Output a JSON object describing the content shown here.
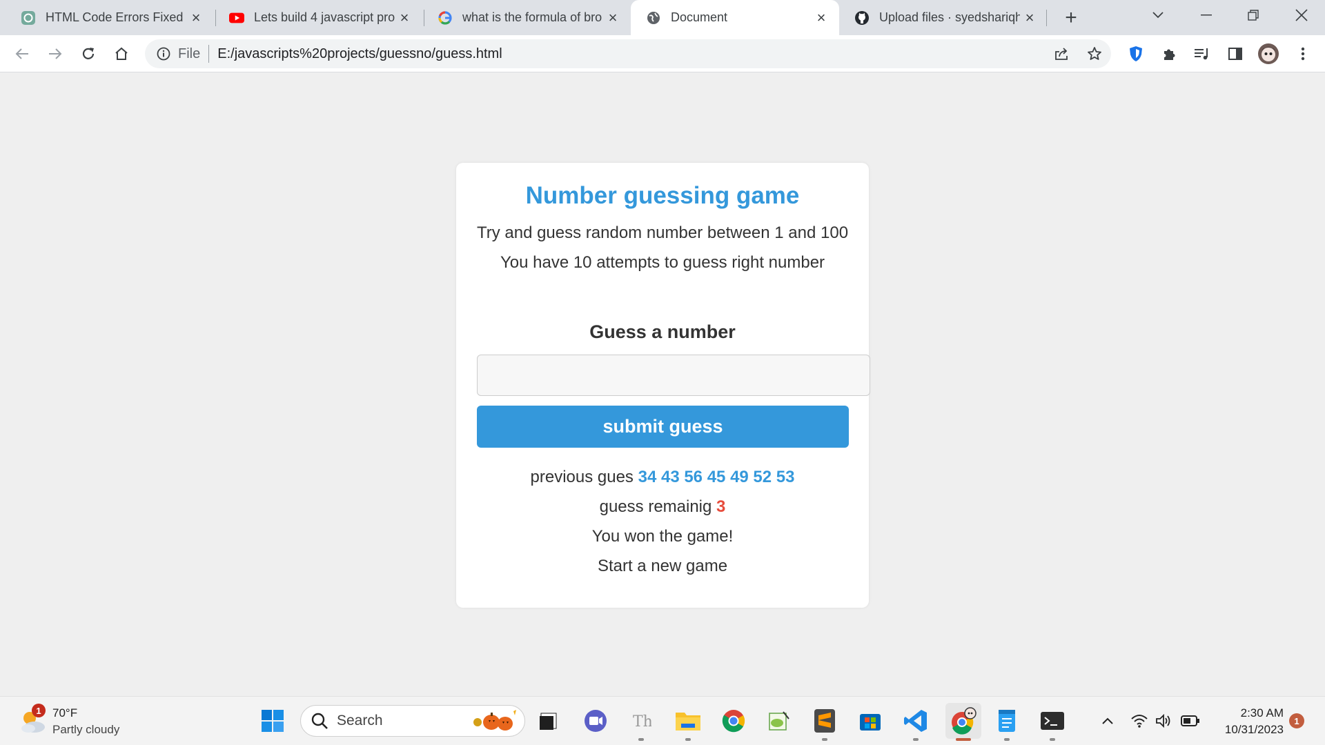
{
  "browser": {
    "tabs": [
      {
        "title": "HTML Code Errors Fixed",
        "icon": "chatgpt-icon",
        "active": false
      },
      {
        "title": "Lets build 4 javascript pro",
        "icon": "youtube-icon",
        "active": false
      },
      {
        "title": "what is the formula of bro",
        "icon": "google-icon",
        "active": false
      },
      {
        "title": "Document",
        "icon": "globe-icon",
        "active": true
      },
      {
        "title": "Upload files · syedshariqh",
        "icon": "github-icon",
        "active": false
      }
    ],
    "address": {
      "scheme_label": "File",
      "url": "E:/javascripts%20projects/guessno/guess.html"
    }
  },
  "page": {
    "title": "Number guessing game",
    "intro_line_1": "Try and guess random number between 1 and 100",
    "intro_line_2": "You have 10 attempts to guess right number",
    "guess_label": "Guess a number",
    "guess_input_value": "",
    "submit_label": "submit guess",
    "previous_label": "previous gues",
    "previous_values": "34 43 56 45 49 52 53",
    "remaining_label": "guess remainig",
    "remaining_value": "3",
    "result_message": "You won the game!",
    "new_game_label": "Start a new game",
    "colors": {
      "accent": "#3498db",
      "danger": "#e74c3c"
    }
  },
  "taskbar": {
    "weather": {
      "temp": "70°F",
      "condition": "Partly cloudy",
      "badge": "1"
    },
    "search_placeholder": "Search",
    "apps": [
      "start-icon",
      "file-explorer-icon",
      "teams-icon",
      "typora-icon",
      "folder-icon",
      "chrome-icon",
      "notepad-plus-icon",
      "sublime-icon",
      "store-icon",
      "vscode-icon",
      "chrome-profile-icon",
      "notepad-icon",
      "terminal-icon"
    ],
    "clock": {
      "time": "2:30 AM",
      "date": "10/31/2023"
    },
    "notification_count": "1"
  }
}
